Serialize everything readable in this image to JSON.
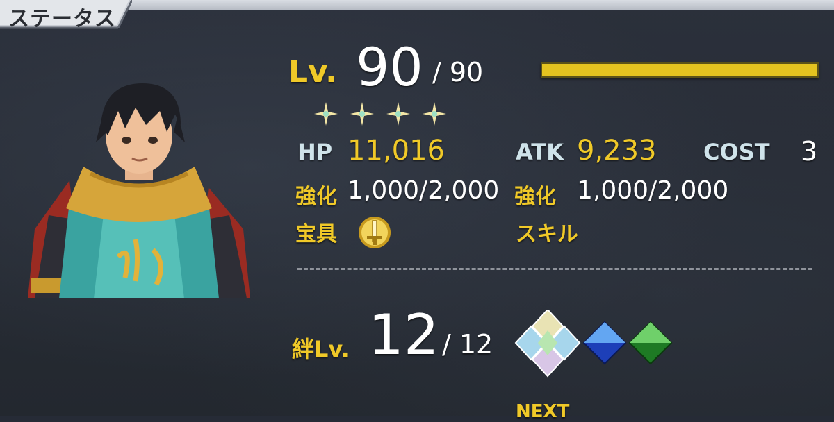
{
  "header": {
    "tab_title": "ステータス"
  },
  "level": {
    "label": "Lv.",
    "current": "90",
    "max": "/ 90",
    "progress": 1.0
  },
  "rarity": {
    "stars": 4
  },
  "stats": {
    "hp_label": "HP",
    "hp_value": "11,016",
    "atk_label": "ATK",
    "atk_value": "9,233",
    "cost_label": "COST",
    "cost_value": "3",
    "hp_enh_label": "強化",
    "hp_enh_value": "1,000/2,000",
    "atk_enh_label": "強化",
    "atk_enh_value": "1,000/2,000",
    "np_label": "宝具",
    "skill_label": "スキル"
  },
  "bond": {
    "label": "絆Lv.",
    "current": "12",
    "max": "/ 12",
    "next_label": "NEXT"
  },
  "colors": {
    "gold": "#f0c928",
    "background": "#262b36",
    "xp_bar": "#e4c320"
  },
  "icons": {
    "np": "sword-coin-icon",
    "stars": "star-icon",
    "gems": [
      "rainbow-gem-icon",
      "blue-gem-icon",
      "green-gem-icon"
    ]
  }
}
